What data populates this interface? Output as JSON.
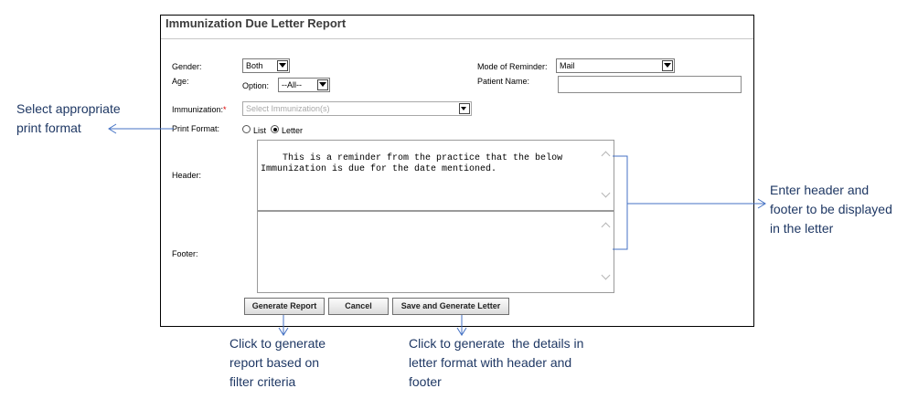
{
  "window": {
    "title": "Immunization Due Letter Report"
  },
  "form": {
    "gender_label": "Gender:",
    "gender_value": "Both",
    "age_label": "Age:",
    "option_label": "Option:",
    "option_value": "--All--",
    "mode_label": "Mode of Reminder:",
    "mode_value": "Mail",
    "patient_label": "Patient Name:",
    "patient_value": "",
    "immunization_label": "Immunization:",
    "immunization_required": "*",
    "immunization_placeholder": "Select Immunization(s)",
    "print_format_label": "Print Format:",
    "print_options": [
      "List",
      "Letter"
    ],
    "print_selected": "Letter",
    "header_label": "Header:",
    "header_text": "This is a reminder from the practice that the below\nImmunization is due for the date mentioned.",
    "footer_label": "Footer:",
    "footer_text": ""
  },
  "buttons": {
    "generate_report": "Generate Report",
    "cancel": "Cancel",
    "save_generate": "Save and Generate Letter"
  },
  "annotations": {
    "print_format": "Select appropriate\nprint format",
    "header_footer": "Enter header and\nfooter to be displayed\nin the letter",
    "generate_report": "Click to generate\nreport based on\nfilter criteria",
    "save_generate": "Click to generate  the details in\nletter format with header and\nfooter"
  },
  "colors": {
    "annotation_text": "#1f3864",
    "annotation_line": "#4472c4",
    "required_marker": "#dd0000"
  }
}
